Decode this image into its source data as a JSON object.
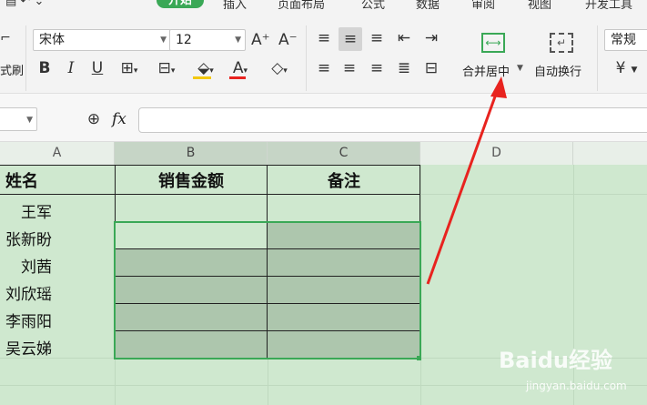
{
  "tabs": [
    "开始",
    "插入",
    "页面布局",
    "公式",
    "数据",
    "审阅",
    "视图",
    "开发工具"
  ],
  "font": {
    "name": "宋体",
    "size": "12"
  },
  "ribbon": {
    "cell_style_label": "式刷",
    "merge_label": "合并居中",
    "wrap_label": "自动换行",
    "number_format": "常规",
    "currency_symbol": "¥"
  },
  "formula": {
    "fx": "fx"
  },
  "columns": [
    "A",
    "B",
    "C",
    "D"
  ],
  "table": {
    "headers": [
      "姓名",
      "销售金额",
      "备注"
    ],
    "names": [
      "王军",
      "张新盼",
      "刘茜",
      "刘欣瑶",
      "李雨阳",
      "吴云娣"
    ]
  },
  "watermark": {
    "brand": "Baidu经验",
    "url": "jingyan.baidu.com"
  },
  "colors": {
    "accent": "#3aa856",
    "selection": "#adc6ad",
    "arrow": "#e8231f"
  }
}
